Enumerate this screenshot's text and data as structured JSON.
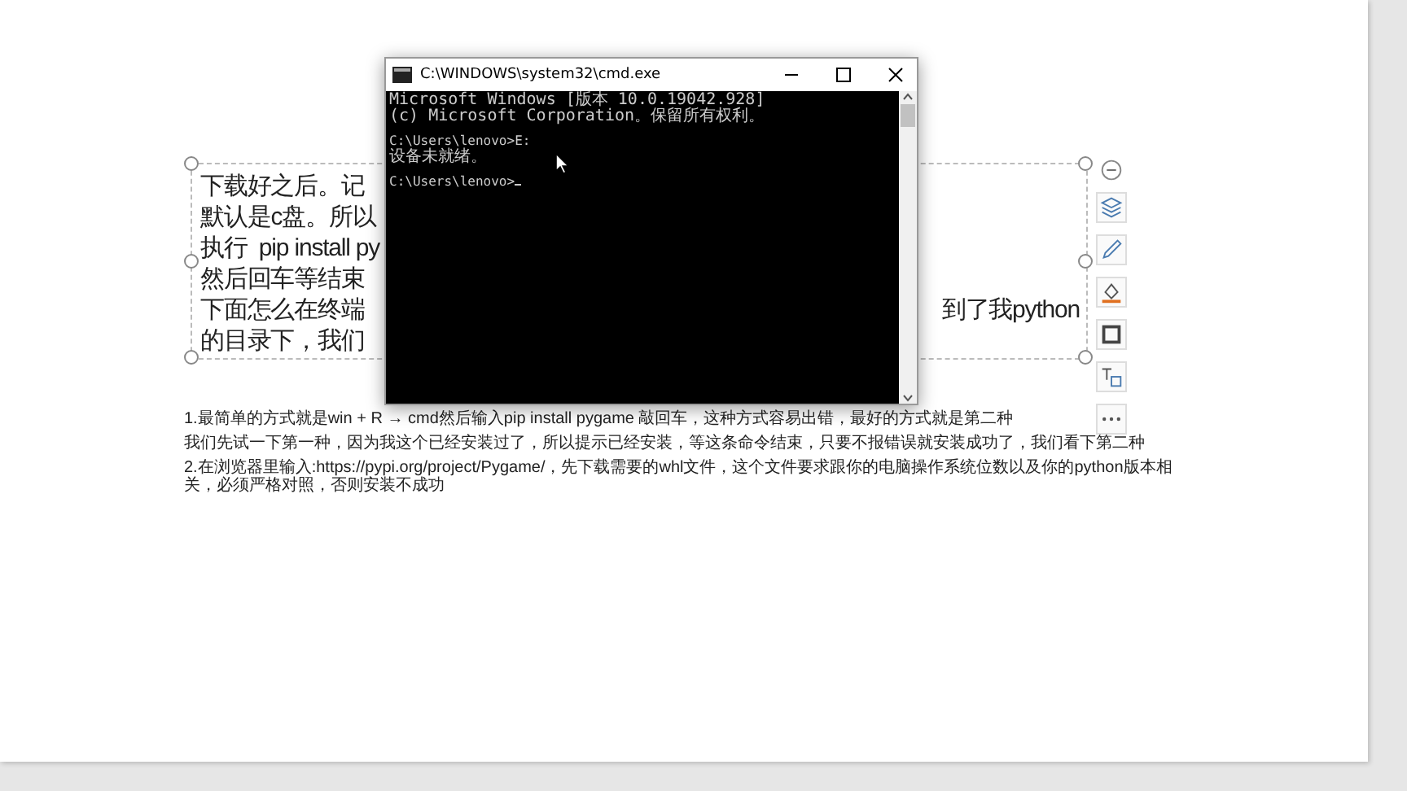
{
  "document": {
    "text_box": {
      "lines": [
        {
          "left": "下载好之后。记"
        },
        {
          "left": "默认是c盘。所以"
        },
        {
          "left": "执行  pip install py"
        },
        {
          "left": "然后回车等结束"
        },
        {
          "left": "下面怎么在终端",
          "right": "到了我python"
        },
        {
          "left": "的目录下，我们"
        }
      ]
    },
    "paragraphs": [
      "1.最简单的方式就是win + R → cmd然后输入pip install pygame 敲回车，这种方式容易出错，最好的方式就是第二种",
      "我们先试一下第一种，因为我这个已经安装过了，所以提示已经安装，等这条命令结束，只要不报错误就安装成功了，我们看下第二种",
      "2.在浏览器里输入:https://pypi.org/project/Pygame/，先下载需要的whl文件，这个文件要求跟你的电脑操作系统位数以及你的python版本相关，必须严格对照，否则安装不成功"
    ]
  },
  "toolbar": {
    "buttons": [
      {
        "kind": "collapse"
      },
      {
        "kind": "layers"
      },
      {
        "kind": "pen"
      },
      {
        "kind": "fill"
      },
      {
        "kind": "border"
      },
      {
        "kind": "text"
      },
      {
        "kind": "more"
      }
    ]
  },
  "cmd_window": {
    "title": "C:\\WINDOWS\\system32\\cmd.exe",
    "blocks": [
      [
        "Microsoft Windows [版本 10.0.19042.928]",
        "(c) Microsoft Corporation。保留所有权利。"
      ],
      [
        "C:\\Users\\lenovo>E:",
        "设备未就绪。"
      ],
      [
        "C:\\Users\\lenovo>"
      ]
    ],
    "cursor": true
  }
}
